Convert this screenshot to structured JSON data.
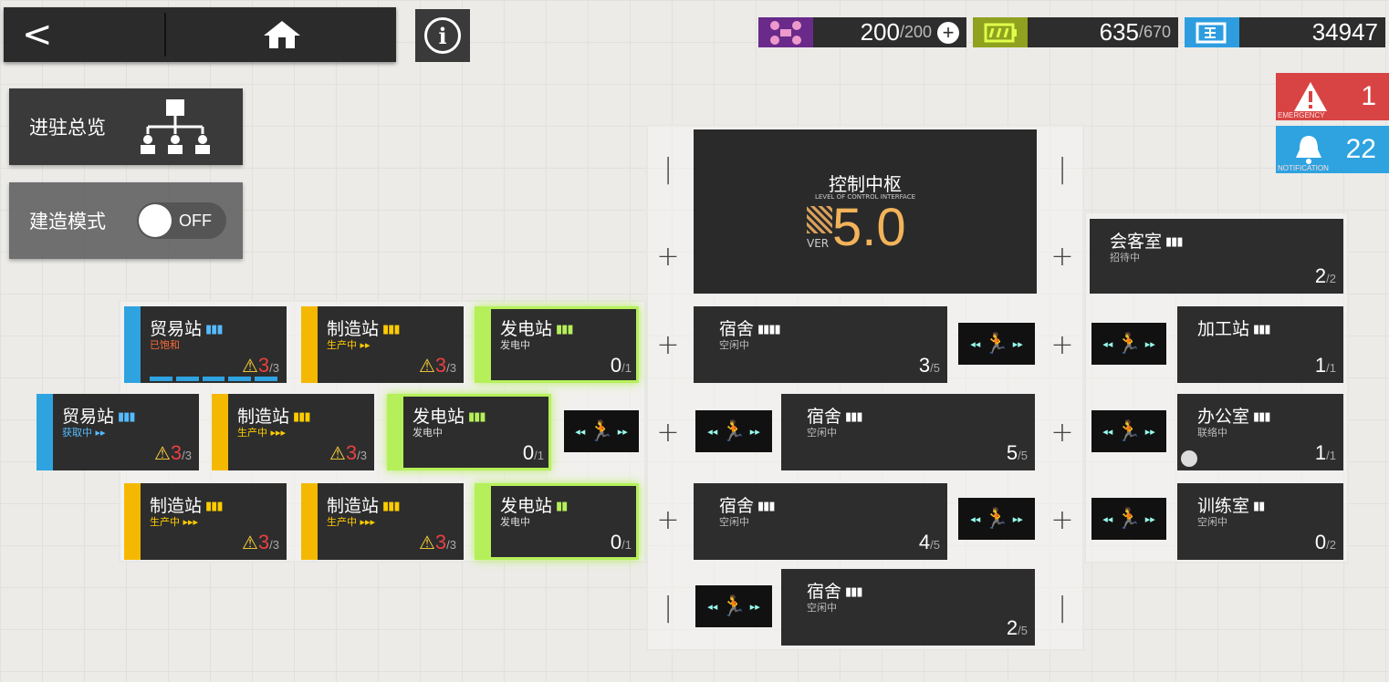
{
  "header": {
    "back_icon": "back-arrow-icon",
    "home_icon": "home-icon",
    "info_icon": "info-icon"
  },
  "resources": {
    "drones": {
      "value": "200",
      "max": "/200",
      "color": "#6a2a8a"
    },
    "power": {
      "value": "635",
      "max": "/670",
      "color": "#8fa11f"
    },
    "lmd": {
      "value": "34947",
      "color": "#2e9de0"
    }
  },
  "alerts": {
    "emergency": {
      "count": "1",
      "label": "EMERGENCY",
      "color": "#d84444"
    },
    "notification": {
      "count": "22",
      "label": "NOTIFICATION",
      "color": "#2ea3e0"
    }
  },
  "left": {
    "overview_label": "进驻总览",
    "build_mode_label": "建造模式",
    "toggle_state": "OFF"
  },
  "control": {
    "title": "控制中枢",
    "subtitle": "LEVEL OF CONTROL INTERFACE",
    "ver": "VER",
    "level": "5.0"
  },
  "rooms": {
    "r1a": {
      "name": "贸易站",
      "status": "已饱和",
      "cap": "3",
      "max": "/3"
    },
    "r1b": {
      "name": "制造站",
      "status": "生产中 ▸▸",
      "cap": "3",
      "max": "/3"
    },
    "r1c": {
      "name": "发电站",
      "status": "发电中",
      "cap": "0",
      "max": "/1"
    },
    "r2a": {
      "name": "贸易站",
      "status": "获取中 ▸▸",
      "cap": "3",
      "max": "/3"
    },
    "r2b": {
      "name": "制造站",
      "status": "生产中 ▸▸▸",
      "cap": "3",
      "max": "/3"
    },
    "r2c": {
      "name": "发电站",
      "status": "发电中",
      "cap": "0",
      "max": "/1"
    },
    "r3a": {
      "name": "制造站",
      "status": "生产中 ▸▸▸",
      "cap": "3",
      "max": "/3"
    },
    "r3b": {
      "name": "制造站",
      "status": "生产中 ▸▸▸",
      "cap": "3",
      "max": "/3"
    },
    "r3c": {
      "name": "发电站",
      "status": "发电中",
      "cap": "0",
      "max": "/1"
    },
    "dorm1": {
      "name": "宿舍",
      "status": "空闲中",
      "cap": "3",
      "max": "/5"
    },
    "dorm2": {
      "name": "宿舍",
      "status": "空闲中",
      "cap": "5",
      "max": "/5"
    },
    "dorm3": {
      "name": "宿舍",
      "status": "空闲中",
      "cap": "4",
      "max": "/5"
    },
    "dorm4": {
      "name": "宿舍",
      "status": "空闲中",
      "cap": "2",
      "max": "/5"
    },
    "reception": {
      "name": "会客室",
      "status": "招待中",
      "cap": "2",
      "max": "/2"
    },
    "workshop": {
      "name": "加工站",
      "status": "",
      "cap": "1",
      "max": "/1"
    },
    "office": {
      "name": "办公室",
      "status": "联络中",
      "cap": "1",
      "max": "/1"
    },
    "training": {
      "name": "训练室",
      "status": "空闲中",
      "cap": "0",
      "max": "/2"
    }
  }
}
